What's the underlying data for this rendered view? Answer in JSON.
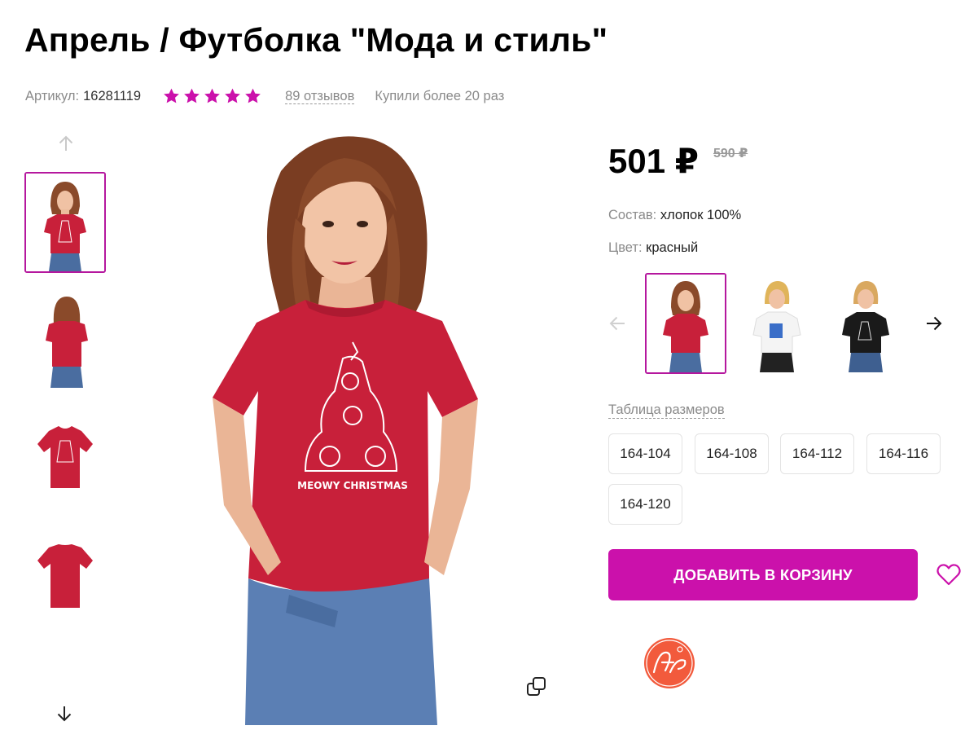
{
  "product": {
    "title": "Апрель / Футболка \"Мода и стиль\"",
    "article_label": "Артикул:",
    "article_value": "16281119",
    "rating": 5,
    "rating_max": 5,
    "reviews": "89 отзывов",
    "bought": "Купили более 20 раз"
  },
  "pricing": {
    "price": "501 ₽",
    "old_price": "590 ₽"
  },
  "attributes": [
    {
      "label": "Состав:",
      "value": "хлопок 100%"
    },
    {
      "label": "Цвет:",
      "value": "красный"
    }
  ],
  "gallery": {
    "thumbnails": [
      "model-front-red",
      "model-back-red",
      "shirt-front-red",
      "shirt-back-red"
    ],
    "active_index": 0
  },
  "colors": {
    "options": [
      "red",
      "white",
      "black"
    ],
    "active_index": 0
  },
  "main_image": {
    "print_text": "MEOWY CHRISTMAS"
  },
  "sizes": {
    "table_link": "Таблица размеров",
    "options": [
      "164-104",
      "164-108",
      "164-112",
      "164-116",
      "164-120"
    ]
  },
  "actions": {
    "add_to_cart": "ДОБАВИТЬ В КОРЗИНУ"
  },
  "brand": {
    "logo_text": "Апрель"
  },
  "theme": {
    "accent": "#cb11ab",
    "active_border": "#b5179e",
    "shirt_red": "#c8203a"
  }
}
